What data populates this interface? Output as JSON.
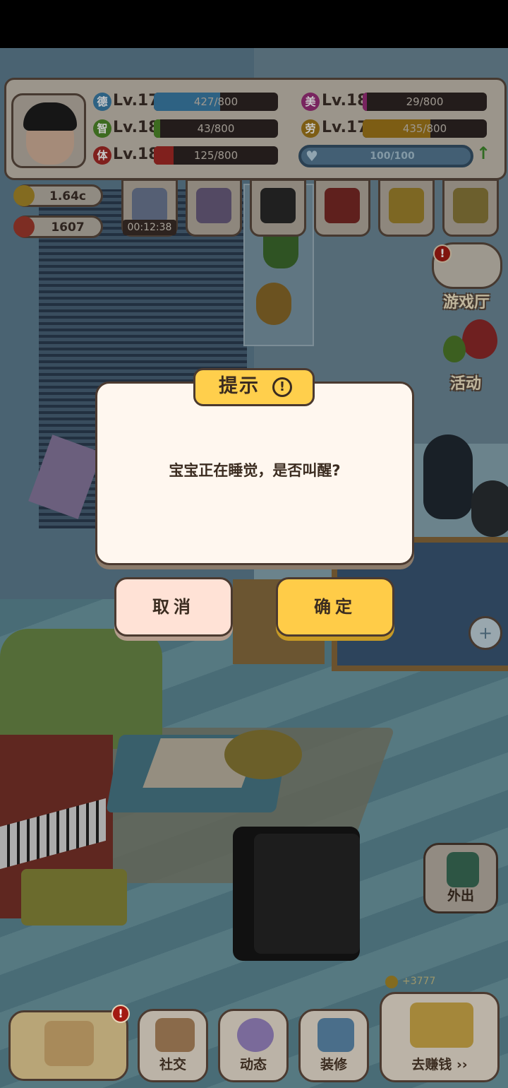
{
  "stats": {
    "de": {
      "icon": "德",
      "level": "Lv.17",
      "value": 427,
      "max": 800,
      "text": "427/800",
      "color": "#3b7ea8"
    },
    "zhi": {
      "icon": "智",
      "level": "Lv.18",
      "value": 43,
      "max": 800,
      "text": "43/800",
      "color": "#4f8a2a"
    },
    "ti": {
      "icon": "体",
      "level": "Lv.18",
      "value": 125,
      "max": 800,
      "text": "125/800",
      "color": "#a52a26"
    },
    "mei": {
      "icon": "美",
      "level": "Lv.18",
      "value": 29,
      "max": 800,
      "text": "29/800",
      "color": "#9a2f7a"
    },
    "lao": {
      "icon": "劳",
      "level": "Lv.17",
      "value": 435,
      "max": 800,
      "text": "435/800",
      "color": "#a0781a"
    },
    "mood": {
      "text": "100/100",
      "value": 100,
      "max": 100
    }
  },
  "currency": {
    "coins": "1.64c",
    "flowers": "1607"
  },
  "toolbar": {
    "timer": "00:12:38"
  },
  "side": {
    "game_hall": "游戏厅",
    "activity": "活动",
    "go_out": "外出",
    "alert": "!"
  },
  "dialog": {
    "title": "提示",
    "info_glyph": "!",
    "message": "宝宝正在睡觉，是否叫醒?",
    "cancel": "取消",
    "confirm": "确定"
  },
  "scene": {
    "coin_gain": "+3777",
    "heart_plus": "+"
  },
  "bottom": {
    "social": "社交",
    "moments": "动态",
    "decorate": "装修",
    "earn": "去赚钱 ››"
  }
}
